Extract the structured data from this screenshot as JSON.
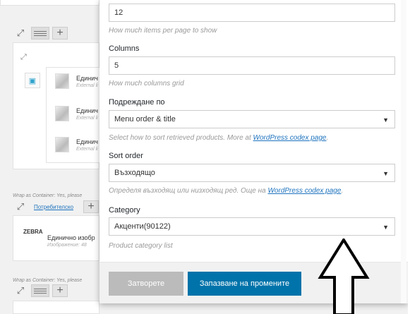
{
  "background": {
    "gallery_items": [
      {
        "title": "Единич",
        "sub": "External li"
      },
      {
        "title": "Единич",
        "sub": "External li"
      },
      {
        "title": "Единич",
        "sub": "External li"
      }
    ],
    "wrap_note_1": "Wrap as Container: Yes, please",
    "tag_link": "Потребителско",
    "single_image_title": "Единично изобр",
    "single_image_sub": "Изображение: 48",
    "wrap_note_2": "Wrap as Container: Yes, please"
  },
  "modal": {
    "per_page_value": "12",
    "per_page_help": "How much items per page to show",
    "columns_label": "Columns",
    "columns_value": "5",
    "columns_help": "How much columns grid",
    "order_label": "Подреждане по",
    "order_value": "Menu order & title",
    "order_help_prefix": "Select how to sort retrieved products. More at ",
    "order_help_link": "WordPress codex page",
    "order_help_suffix": ".",
    "sort_label": "Sort order",
    "sort_value": "Възходящо",
    "sort_help_prefix": "Определя възходящ или низходящ ред. Още на ",
    "sort_help_link": "WordPress codex page",
    "sort_help_suffix": ".",
    "category_label": "Category",
    "category_value": "Акценти(90122)",
    "category_help": "Product category list",
    "close_button": "Затворете",
    "save_button": "Запазване на промените"
  }
}
